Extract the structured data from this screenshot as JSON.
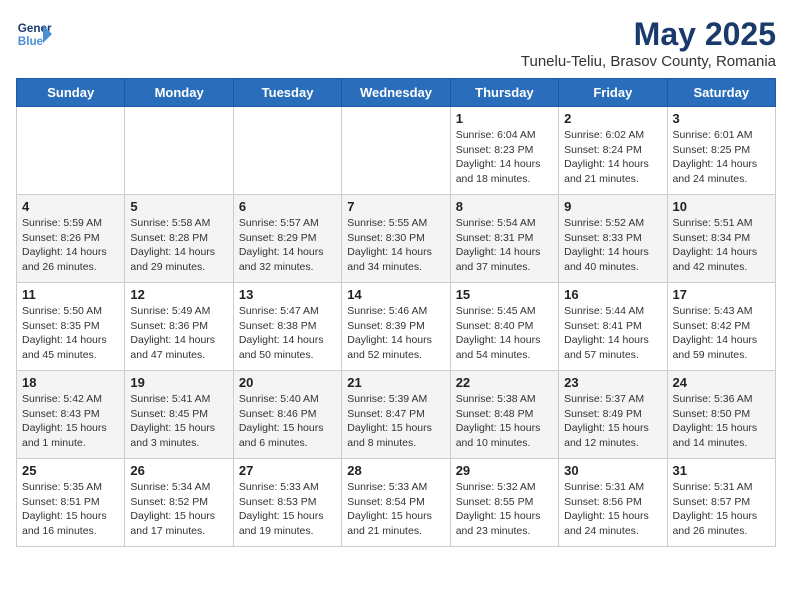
{
  "header": {
    "logo_line1": "General",
    "logo_line2": "Blue",
    "title": "May 2025",
    "subtitle": "Tunelu-Teliu, Brasov County, Romania"
  },
  "days_of_week": [
    "Sunday",
    "Monday",
    "Tuesday",
    "Wednesday",
    "Thursday",
    "Friday",
    "Saturday"
  ],
  "weeks": [
    [
      {
        "date": "",
        "info": ""
      },
      {
        "date": "",
        "info": ""
      },
      {
        "date": "",
        "info": ""
      },
      {
        "date": "",
        "info": ""
      },
      {
        "date": "1",
        "info": "Sunrise: 6:04 AM\nSunset: 8:23 PM\nDaylight: 14 hours\nand 18 minutes."
      },
      {
        "date": "2",
        "info": "Sunrise: 6:02 AM\nSunset: 8:24 PM\nDaylight: 14 hours\nand 21 minutes."
      },
      {
        "date": "3",
        "info": "Sunrise: 6:01 AM\nSunset: 8:25 PM\nDaylight: 14 hours\nand 24 minutes."
      }
    ],
    [
      {
        "date": "4",
        "info": "Sunrise: 5:59 AM\nSunset: 8:26 PM\nDaylight: 14 hours\nand 26 minutes."
      },
      {
        "date": "5",
        "info": "Sunrise: 5:58 AM\nSunset: 8:28 PM\nDaylight: 14 hours\nand 29 minutes."
      },
      {
        "date": "6",
        "info": "Sunrise: 5:57 AM\nSunset: 8:29 PM\nDaylight: 14 hours\nand 32 minutes."
      },
      {
        "date": "7",
        "info": "Sunrise: 5:55 AM\nSunset: 8:30 PM\nDaylight: 14 hours\nand 34 minutes."
      },
      {
        "date": "8",
        "info": "Sunrise: 5:54 AM\nSunset: 8:31 PM\nDaylight: 14 hours\nand 37 minutes."
      },
      {
        "date": "9",
        "info": "Sunrise: 5:52 AM\nSunset: 8:33 PM\nDaylight: 14 hours\nand 40 minutes."
      },
      {
        "date": "10",
        "info": "Sunrise: 5:51 AM\nSunset: 8:34 PM\nDaylight: 14 hours\nand 42 minutes."
      }
    ],
    [
      {
        "date": "11",
        "info": "Sunrise: 5:50 AM\nSunset: 8:35 PM\nDaylight: 14 hours\nand 45 minutes."
      },
      {
        "date": "12",
        "info": "Sunrise: 5:49 AM\nSunset: 8:36 PM\nDaylight: 14 hours\nand 47 minutes."
      },
      {
        "date": "13",
        "info": "Sunrise: 5:47 AM\nSunset: 8:38 PM\nDaylight: 14 hours\nand 50 minutes."
      },
      {
        "date": "14",
        "info": "Sunrise: 5:46 AM\nSunset: 8:39 PM\nDaylight: 14 hours\nand 52 minutes."
      },
      {
        "date": "15",
        "info": "Sunrise: 5:45 AM\nSunset: 8:40 PM\nDaylight: 14 hours\nand 54 minutes."
      },
      {
        "date": "16",
        "info": "Sunrise: 5:44 AM\nSunset: 8:41 PM\nDaylight: 14 hours\nand 57 minutes."
      },
      {
        "date": "17",
        "info": "Sunrise: 5:43 AM\nSunset: 8:42 PM\nDaylight: 14 hours\nand 59 minutes."
      }
    ],
    [
      {
        "date": "18",
        "info": "Sunrise: 5:42 AM\nSunset: 8:43 PM\nDaylight: 15 hours\nand 1 minute."
      },
      {
        "date": "19",
        "info": "Sunrise: 5:41 AM\nSunset: 8:45 PM\nDaylight: 15 hours\nand 3 minutes."
      },
      {
        "date": "20",
        "info": "Sunrise: 5:40 AM\nSunset: 8:46 PM\nDaylight: 15 hours\nand 6 minutes."
      },
      {
        "date": "21",
        "info": "Sunrise: 5:39 AM\nSunset: 8:47 PM\nDaylight: 15 hours\nand 8 minutes."
      },
      {
        "date": "22",
        "info": "Sunrise: 5:38 AM\nSunset: 8:48 PM\nDaylight: 15 hours\nand 10 minutes."
      },
      {
        "date": "23",
        "info": "Sunrise: 5:37 AM\nSunset: 8:49 PM\nDaylight: 15 hours\nand 12 minutes."
      },
      {
        "date": "24",
        "info": "Sunrise: 5:36 AM\nSunset: 8:50 PM\nDaylight: 15 hours\nand 14 minutes."
      }
    ],
    [
      {
        "date": "25",
        "info": "Sunrise: 5:35 AM\nSunset: 8:51 PM\nDaylight: 15 hours\nand 16 minutes."
      },
      {
        "date": "26",
        "info": "Sunrise: 5:34 AM\nSunset: 8:52 PM\nDaylight: 15 hours\nand 17 minutes."
      },
      {
        "date": "27",
        "info": "Sunrise: 5:33 AM\nSunset: 8:53 PM\nDaylight: 15 hours\nand 19 minutes."
      },
      {
        "date": "28",
        "info": "Sunrise: 5:33 AM\nSunset: 8:54 PM\nDaylight: 15 hours\nand 21 minutes."
      },
      {
        "date": "29",
        "info": "Sunrise: 5:32 AM\nSunset: 8:55 PM\nDaylight: 15 hours\nand 23 minutes."
      },
      {
        "date": "30",
        "info": "Sunrise: 5:31 AM\nSunset: 8:56 PM\nDaylight: 15 hours\nand 24 minutes."
      },
      {
        "date": "31",
        "info": "Sunrise: 5:31 AM\nSunset: 8:57 PM\nDaylight: 15 hours\nand 26 minutes."
      }
    ]
  ]
}
